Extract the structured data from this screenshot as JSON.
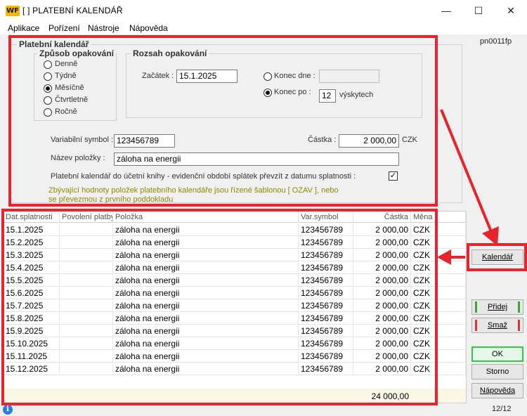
{
  "window": {
    "logo": "WF",
    "title": "[                       ] PLATEBNÍ KALENDÁŘ",
    "controls": {
      "minimize": "—",
      "maximize": "☐",
      "close": "✕"
    }
  },
  "menu": [
    "Aplikace",
    "Pořízení",
    "Nástroje",
    "Nápověda"
  ],
  "form_code": "pn0011fp",
  "form": {
    "section_title": "Platební kalendář",
    "repeat_type": {
      "title": "Způsob opakování",
      "options": [
        "Denně",
        "Týdně",
        "Měsíčně",
        "Čtvrtletně",
        "Ročně"
      ],
      "selected": "Měsíčně"
    },
    "range": {
      "title": "Rozsah opakování",
      "start_label": "Začátek :",
      "start_value": "15.1.2025",
      "end_date_label": "Konec dne :",
      "end_date_value": "",
      "end_after_label": "Konec po :",
      "end_after_value": "12",
      "occurrences_label": "výskytech",
      "selected": "Konec po"
    },
    "variable_symbol_label": "Variabilní symbol :",
    "variable_symbol_value": "123456789",
    "amount_label": "Částka :",
    "amount_value": "2 000,00",
    "currency": "CZK",
    "item_name_label": "Název položky :",
    "item_name_value": "záloha na energii",
    "checkbox_label": "Platební kalendář do účetní knihy - evidenční období splátek převzít z datumu splatnosti :",
    "checkbox_checked": true,
    "checkbox_mark": "✓",
    "note_line1": "Zbývající hodnoty položek platebního kalendáře jsou řízené šablonou [ OZAV ], nebo",
    "note_line2": "se převezmou z  prvního poddokladu"
  },
  "table": {
    "headers": [
      "Dat.splatnosti",
      "Povolení platby",
      "Položka",
      "Var.symbol",
      "Částka",
      "Měna"
    ],
    "rows": [
      [
        "15.1.2025",
        "",
        "záloha na energii",
        "123456789",
        "2 000,00",
        "CZK"
      ],
      [
        "15.2.2025",
        "",
        "záloha na energii",
        "123456789",
        "2 000,00",
        "CZK"
      ],
      [
        "15.3.2025",
        "",
        "záloha na energii",
        "123456789",
        "2 000,00",
        "CZK"
      ],
      [
        "15.4.2025",
        "",
        "záloha na energii",
        "123456789",
        "2 000,00",
        "CZK"
      ],
      [
        "15.5.2025",
        "",
        "záloha na energii",
        "123456789",
        "2 000,00",
        "CZK"
      ],
      [
        "15.6.2025",
        "",
        "záloha na energii",
        "123456789",
        "2 000,00",
        "CZK"
      ],
      [
        "15.7.2025",
        "",
        "záloha na energii",
        "123456789",
        "2 000,00",
        "CZK"
      ],
      [
        "15.8.2025",
        "",
        "záloha na energii",
        "123456789",
        "2 000,00",
        "CZK"
      ],
      [
        "15.9.2025",
        "",
        "záloha na energii",
        "123456789",
        "2 000,00",
        "CZK"
      ],
      [
        "15.10.2025",
        "",
        "záloha na energii",
        "123456789",
        "2 000,00",
        "CZK"
      ],
      [
        "15.11.2025",
        "",
        "záloha na energii",
        "123456789",
        "2 000,00",
        "CZK"
      ],
      [
        "15.12.2025",
        "",
        "záloha na energii",
        "123456789",
        "2 000,00",
        "CZK"
      ]
    ],
    "total": "24 000,00"
  },
  "sidebar": {
    "kalendar": "Kalendář",
    "pridej": "Přidej",
    "smaz": "Smaž",
    "ok": "OK",
    "storno": "Storno",
    "napoveda": "Nápověda"
  },
  "status": {
    "info_icon": "i",
    "record_counter": "12/12"
  },
  "colors": {
    "annotation_red": "#e8232b",
    "ok_border": "#2ecc40",
    "add_marker": "#3aa53a",
    "delete_marker": "#d33",
    "note_text": "#8a8a00",
    "footer_bg": "#fbf7e6"
  }
}
